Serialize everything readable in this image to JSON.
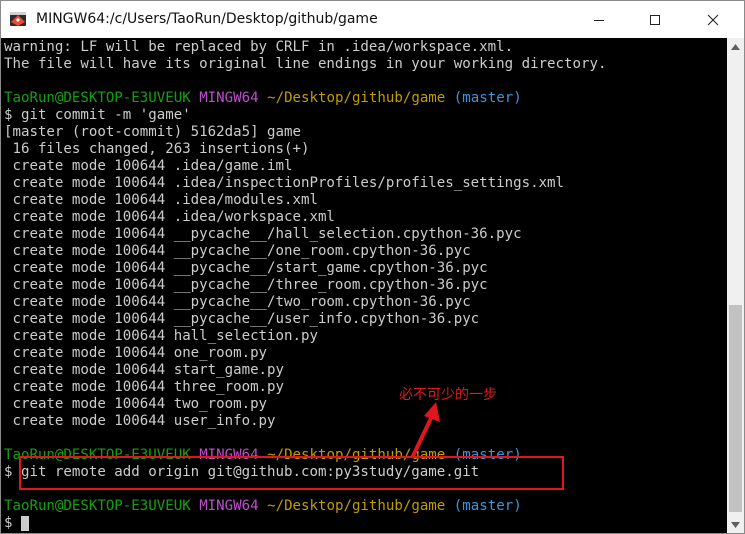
{
  "window": {
    "title": "MINGW64:/c/Users/TaoRun/Desktop/github/game",
    "controls": {
      "minimize": "minimize-icon",
      "maximize": "maximize-icon",
      "close": "close-icon"
    }
  },
  "colors": {
    "user": "#13a10e",
    "host": "#c04ecf",
    "path": "#c19c00",
    "branch": "#3a96dd",
    "text": "#cccccc",
    "annotation": "#e0161c"
  },
  "terminal": {
    "warning_1": "warning: LF will be replaced by CRLF in .idea/workspace.xml.",
    "warning_2": "The file will have its original line endings in your working directory.",
    "prompt": {
      "user": "TaoRun@DESKTOP-E3UVEUK",
      "host": "MINGW64",
      "path": "~/Desktop/github/game",
      "branch": "(master)"
    },
    "commit_cmd": "$ git commit -m 'game'",
    "commit_out": "[master (root-commit) 5162da5] game",
    "stats": " 16 files changed, 263 insertions(+)",
    "created": [
      " create mode 100644 .idea/game.iml",
      " create mode 100644 .idea/inspectionProfiles/profiles_settings.xml",
      " create mode 100644 .idea/modules.xml",
      " create mode 100644 .idea/workspace.xml",
      " create mode 100644 __pycache__/hall_selection.cpython-36.pyc",
      " create mode 100644 __pycache__/one_room.cpython-36.pyc",
      " create mode 100644 __pycache__/start_game.cpython-36.pyc",
      " create mode 100644 __pycache__/three_room.cpython-36.pyc",
      " create mode 100644 __pycache__/two_room.cpython-36.pyc",
      " create mode 100644 __pycache__/user_info.cpython-36.pyc",
      " create mode 100644 hall_selection.py",
      " create mode 100644 one_room.py",
      " create mode 100644 start_game.py",
      " create mode 100644 three_room.py",
      " create mode 100644 two_room.py",
      " create mode 100644 user_info.py"
    ],
    "remote_cmd": "$ git remote add origin git@github.com:py3study/game.git",
    "final_prompt": "$"
  },
  "annotation": {
    "text": "必不可少的一步"
  }
}
